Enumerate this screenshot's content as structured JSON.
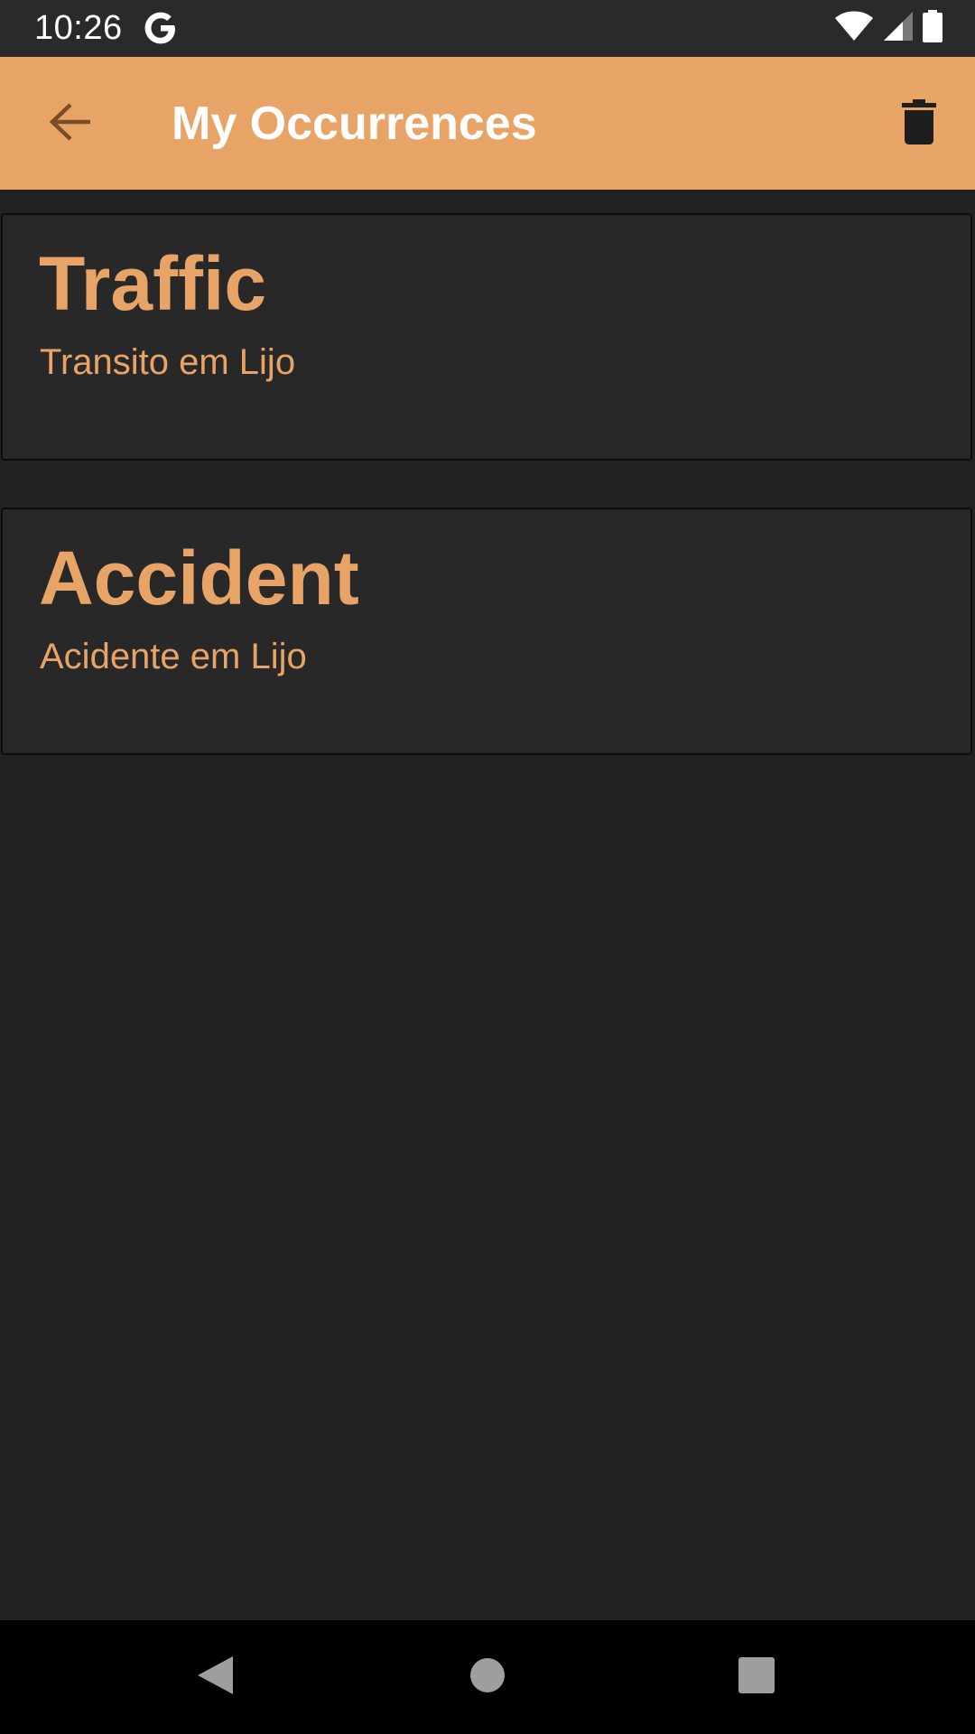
{
  "status_bar": {
    "time": "10:26",
    "icons": [
      "google-g-icon",
      "wifi-icon",
      "cellular-signal-icon",
      "battery-icon"
    ]
  },
  "app_bar": {
    "title": "My Occurrences",
    "back_icon": "arrow-back-icon",
    "delete_icon": "trash-icon",
    "background_color": "#e8a466"
  },
  "occurrences": [
    {
      "type": "Traffic",
      "description": "Transito em Lijo"
    },
    {
      "type": "Accident",
      "description": "Acidente em Lijo"
    }
  ],
  "nav_bar": {
    "buttons": [
      "back-triangle-icon",
      "home-circle-icon",
      "recents-square-icon"
    ]
  },
  "colors": {
    "accent": "#e8a466",
    "background": "#222222",
    "card": "#282828"
  }
}
